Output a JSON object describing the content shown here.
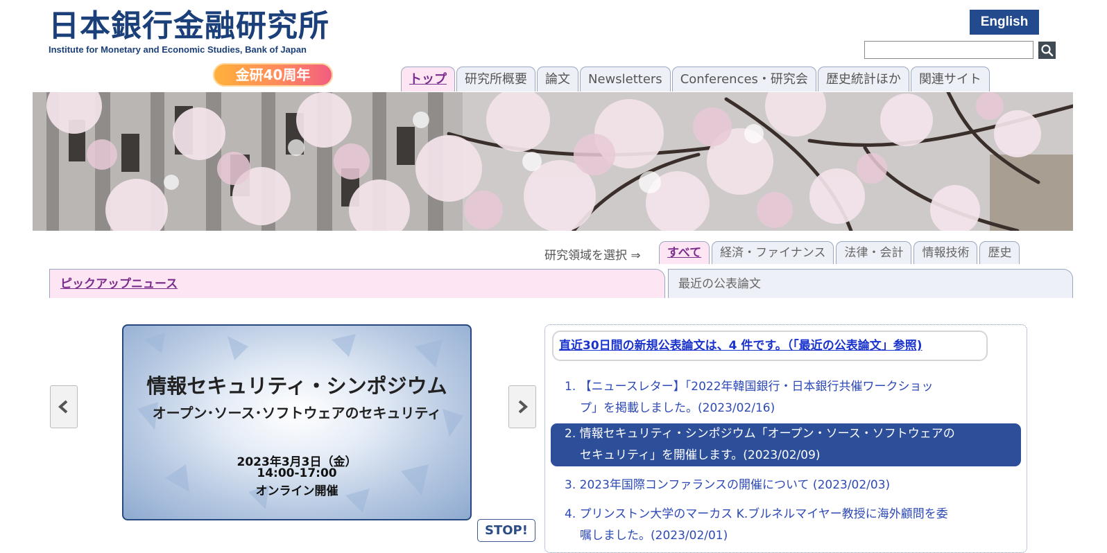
{
  "header": {
    "logo_jp": "日本銀行金融研究所",
    "logo_en": "Institute for Monetary and Economic Studies, Bank of Japan",
    "anniversary": "金研40周年",
    "english_label": "English",
    "search_placeholder": ""
  },
  "nav": {
    "tabs": [
      "トップ",
      "研究所概要",
      "論文",
      "Newsletters",
      "Conferences・研究会",
      "歴史統計ほか",
      "関連サイト"
    ]
  },
  "area": {
    "label": "研究領域を選択 ⇒",
    "tabs": [
      "すべて",
      "経済・ファイナンス",
      "法律・会計",
      "情報技術",
      "歴史"
    ]
  },
  "content_tabs": {
    "pickup": "ピックアップニュース",
    "recent": "最近の公表論文"
  },
  "slide": {
    "title": "情報セキュリティ・シンポジウム",
    "subtitle": "オープン･ソース･ソフトウェアのセキュリティ",
    "date": "2023年3月3日（金）",
    "time": "14:00-17:00",
    "format": "オンライン開催",
    "stop_label": "STOP!"
  },
  "news": {
    "heading": "直近30日間の新規公表論文は、4 件です。（「最近の公表論文」参照)",
    "items": [
      {
        "line1": "1. 【ニュースレター】「2022年韓国銀行・日本銀行共催ワークショッ",
        "line2": "プ」を掲載しました。(2023/02/16)"
      },
      {
        "line1": "2. 情報セキュリティ・シンポジウム「オープン・ソース・ソフトウェアの",
        "line2": "セキュリティ」を開催します。(2023/02/09)"
      },
      {
        "line1": "3. 2023年国際コンファランスの開催について (2023/02/03)",
        "line2": ""
      },
      {
        "line1": "4. プリンストン大学のマーカス K.ブルネルマイヤー教授に海外顧問を委",
        "line2": "嘱しました。(2023/02/01)"
      }
    ]
  },
  "colors": {
    "brand_blue": "#234a8c",
    "active_tab": "#fde5f3",
    "highlight_item": "#2d4f9a"
  }
}
